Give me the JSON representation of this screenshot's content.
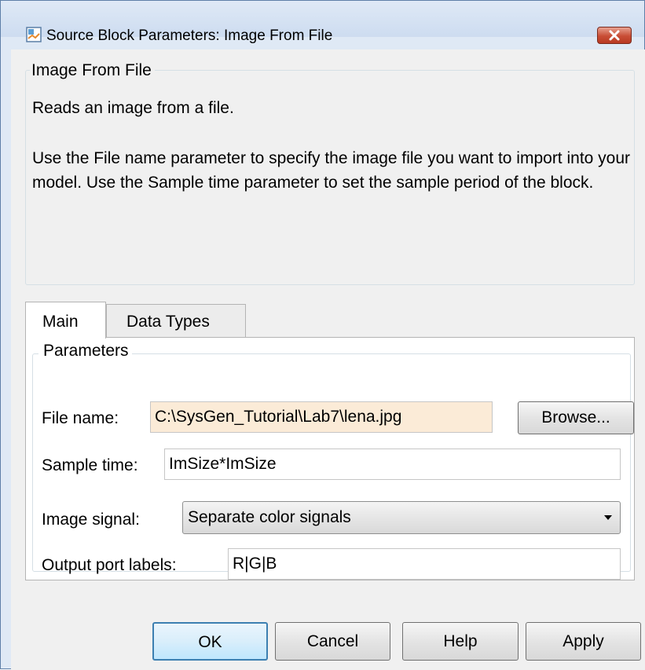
{
  "window": {
    "title": "Source Block Parameters: Image From File"
  },
  "description": {
    "group_title": "Image From File",
    "line1": "Reads an image from a file.",
    "paragraph2": "Use the File name parameter to specify the image file you want to import into your model. Use the Sample time parameter to set the sample period of the block."
  },
  "tabs": [
    {
      "label": "Main",
      "selected": true
    },
    {
      "label": "Data Types",
      "selected": false
    }
  ],
  "parameters": {
    "group_title": "Parameters",
    "file_name": {
      "label": "File name:",
      "value": "C:\\SysGen_Tutorial\\Lab7\\lena.jpg",
      "browse_label": "Browse..."
    },
    "sample_time": {
      "label": "Sample time:",
      "value": "ImSize*ImSize"
    },
    "image_signal": {
      "label": "Image signal:",
      "value": "Separate color signals"
    },
    "output_port_labels": {
      "label": "Output port labels:",
      "value": "R|G|B"
    }
  },
  "buttons": {
    "ok": "OK",
    "cancel": "Cancel",
    "help": "Help",
    "apply": "Apply"
  },
  "colors": {
    "highlight_field": "#fbebd7",
    "close_button": "#c84d35",
    "default_button_border": "#3c7fb1"
  },
  "icons": {
    "title": "simulink-block-icon",
    "close": "close-icon",
    "dropdown": "chevron-down-icon"
  }
}
